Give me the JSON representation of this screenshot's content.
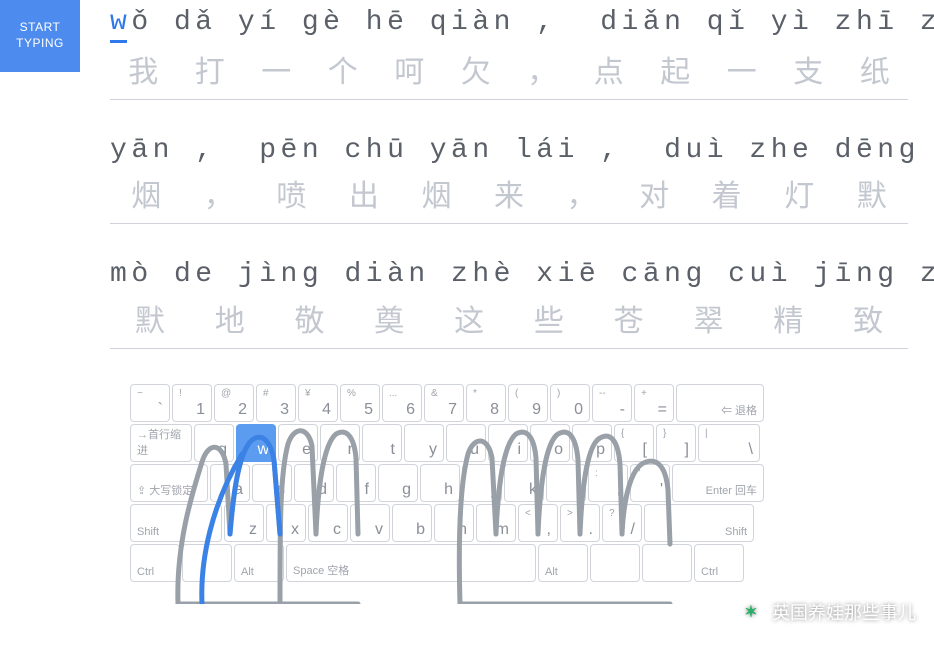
{
  "start_button": {
    "label": "START\nTYPING"
  },
  "lines": [
    {
      "pinyin": "wǒ dǎ yí gè hē qiàn ,  diǎn qǐ yì zhī zhǐ",
      "hanzi": "我打一个呵欠，点起一支纸"
    },
    {
      "pinyin": "yān ,  pēn chū yān lái ,  duì zhe dēng mò",
      "hanzi": "烟，喷出烟来，对着灯默"
    },
    {
      "pinyin": "mò de jìng diàn zhè xiē cāng cuì jīng zhì",
      "hanzi": "默地敬奠这些苍翠精致"
    }
  ],
  "current_char_index": 0,
  "keyboard": {
    "rows": [
      [
        {
          "w": "w40",
          "sup": "~",
          "main": "`"
        },
        {
          "w": "w40",
          "sup": "!",
          "main": "1"
        },
        {
          "w": "w40",
          "sup": "@",
          "main": "2"
        },
        {
          "w": "w40",
          "sup": "#",
          "main": "3"
        },
        {
          "w": "w40",
          "sup": "¥",
          "main": "4"
        },
        {
          "w": "w40",
          "sup": "%",
          "main": "5"
        },
        {
          "w": "w40",
          "sup": "...",
          "main": "6"
        },
        {
          "w": "w40",
          "sup": "&",
          "main": "7"
        },
        {
          "w": "w40",
          "sup": "*",
          "main": "8"
        },
        {
          "w": "w40",
          "sup": "(",
          "main": "9"
        },
        {
          "w": "w40",
          "sup": ")",
          "main": "0"
        },
        {
          "w": "w40",
          "sup": "--",
          "main": "-"
        },
        {
          "w": "w40",
          "sup": "+",
          "main": "="
        },
        {
          "w": "w88",
          "labelR": "⇐ 退格"
        }
      ],
      [
        {
          "w": "w62",
          "label": "→首行缩进"
        },
        {
          "w": "w40",
          "main": "q"
        },
        {
          "w": "w40",
          "main": "w",
          "hi": true
        },
        {
          "w": "w40",
          "main": "e"
        },
        {
          "w": "w40",
          "main": "r"
        },
        {
          "w": "w40",
          "main": "t"
        },
        {
          "w": "w40",
          "main": "y"
        },
        {
          "w": "w40",
          "main": "u"
        },
        {
          "w": "w40",
          "main": "i"
        },
        {
          "w": "w40",
          "main": "o"
        },
        {
          "w": "w40",
          "main": "p"
        },
        {
          "w": "w40",
          "sup": "{",
          "main": "["
        },
        {
          "w": "w40",
          "sup": "}",
          "main": "]"
        },
        {
          "w": "w62",
          "sup": "|",
          "main": "\\"
        }
      ],
      [
        {
          "w": "w78",
          "label": "⇪ 大写锁定"
        },
        {
          "w": "w40",
          "main": "a"
        },
        {
          "w": "w40",
          "main": "s"
        },
        {
          "w": "w40",
          "main": "d"
        },
        {
          "w": "w40",
          "main": "f"
        },
        {
          "w": "w40",
          "main": "g"
        },
        {
          "w": "w40",
          "main": "h"
        },
        {
          "w": "w40",
          "main": "j"
        },
        {
          "w": "w40",
          "main": "k"
        },
        {
          "w": "w40",
          "main": "l"
        },
        {
          "w": "w40",
          "sup": ":",
          "main": ";"
        },
        {
          "w": "w40",
          "sup": "\"",
          "main": "'"
        },
        {
          "w": "w92",
          "labelR": "Enter 回车"
        }
      ],
      [
        {
          "w": "w92",
          "label": "Shift"
        },
        {
          "w": "w40",
          "main": "z"
        },
        {
          "w": "w40",
          "main": "x"
        },
        {
          "w": "w40",
          "main": "c"
        },
        {
          "w": "w40",
          "main": "v"
        },
        {
          "w": "w40",
          "main": "b"
        },
        {
          "w": "w40",
          "main": "n"
        },
        {
          "w": "w40",
          "main": "m"
        },
        {
          "w": "w40",
          "sup": "<",
          "main": ","
        },
        {
          "w": "w40",
          "sup": ">",
          "main": "."
        },
        {
          "w": "w40",
          "sup": "?",
          "main": "/"
        },
        {
          "w": "w110",
          "labelR": "Shift"
        }
      ],
      [
        {
          "w": "w50",
          "label": "Ctrl"
        },
        {
          "w": "w50"
        },
        {
          "w": "w50",
          "label": "Alt"
        },
        {
          "w": "w250",
          "label": "Space 空格"
        },
        {
          "w": "w50",
          "label": "Alt"
        },
        {
          "w": "w50"
        },
        {
          "w": "w50"
        },
        {
          "w": "w50",
          "label": "Ctrl"
        }
      ]
    ]
  },
  "watermark": {
    "text": "英国养娃那些事儿",
    "icon_glyph": "✶"
  }
}
